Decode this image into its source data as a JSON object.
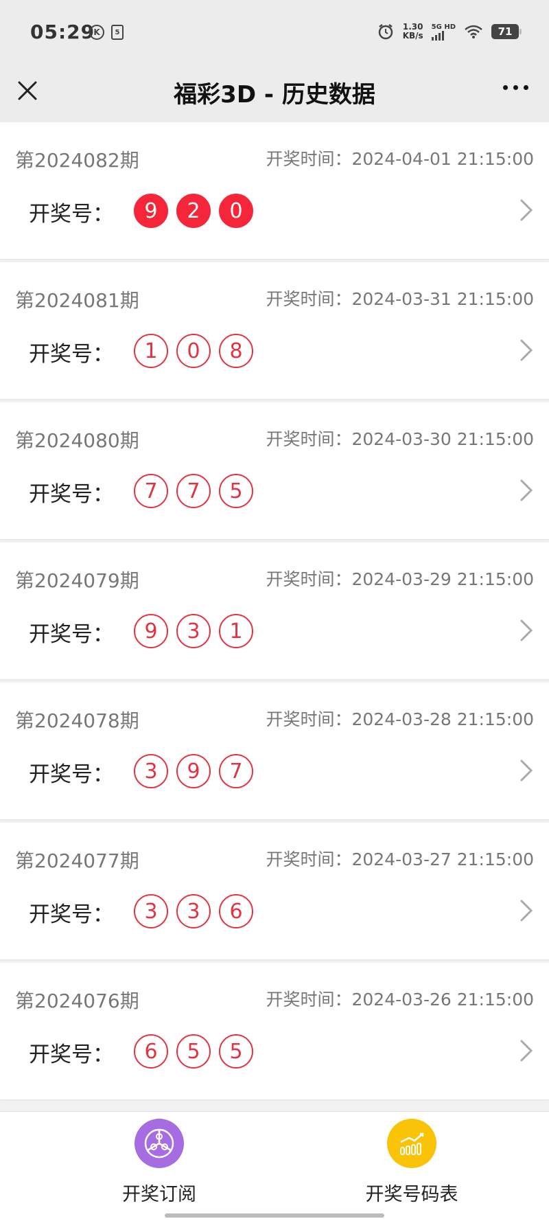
{
  "status_bar": {
    "time": "05:29",
    "net_speed_value": "1.30",
    "net_speed_unit": "KB/s",
    "net_type": "5G HD",
    "battery": "71"
  },
  "nav": {
    "title": "福彩3D - 历史数据",
    "close_icon": "close-icon",
    "more_icon": "more-icon"
  },
  "labels": {
    "numbers_label": "开奖号："
  },
  "colors": {
    "accent_red": "#f5263a",
    "ball_outline": "#e33340",
    "subscribe_icon_bg": "#a66de3",
    "chart_icon_bg": "#f9c407"
  },
  "draws": [
    {
      "issue": "第2024082期",
      "time": "开奖时间：2024-04-01 21:15:00",
      "numbers": [
        "9",
        "2",
        "0"
      ],
      "highlight": true
    },
    {
      "issue": "第2024081期",
      "time": "开奖时间：2024-03-31 21:15:00",
      "numbers": [
        "1",
        "0",
        "8"
      ],
      "highlight": false
    },
    {
      "issue": "第2024080期",
      "time": "开奖时间：2024-03-30 21:15:00",
      "numbers": [
        "7",
        "7",
        "5"
      ],
      "highlight": false
    },
    {
      "issue": "第2024079期",
      "time": "开奖时间：2024-03-29 21:15:00",
      "numbers": [
        "9",
        "3",
        "1"
      ],
      "highlight": false
    },
    {
      "issue": "第2024078期",
      "time": "开奖时间：2024-03-28 21:15:00",
      "numbers": [
        "3",
        "9",
        "7"
      ],
      "highlight": false
    },
    {
      "issue": "第2024077期",
      "time": "开奖时间：2024-03-27 21:15:00",
      "numbers": [
        "3",
        "3",
        "6"
      ],
      "highlight": false
    },
    {
      "issue": "第2024076期",
      "time": "开奖时间：2024-03-26 21:15:00",
      "numbers": [
        "6",
        "5",
        "5"
      ],
      "highlight": false
    }
  ],
  "bottom_tabs": [
    {
      "label": "开奖订阅",
      "icon": "subscribe-icon"
    },
    {
      "label": "开奖号码表",
      "icon": "chart-icon"
    }
  ]
}
